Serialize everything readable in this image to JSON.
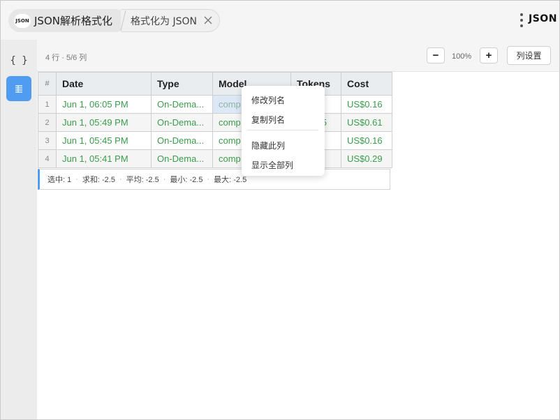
{
  "header": {
    "app_badge": "JSON",
    "app_title": "JSON解析格式化",
    "tab_label": "格式化为 JSON",
    "brand": "JSON"
  },
  "sidebar": {
    "items": [
      {
        "label": "{ }",
        "icon": "braces-icon",
        "active": false
      },
      {
        "label": "",
        "icon": "table-view-icon",
        "active": true
      }
    ]
  },
  "toolbar": {
    "summary": "4 行 · 5/6 列",
    "zoom_out": "−",
    "zoom_level": "100%",
    "zoom_in": "+",
    "column_settings": "列设置"
  },
  "table": {
    "index_header": "#",
    "columns": [
      "Date",
      "Type",
      "Model",
      "Tokens",
      "Cost"
    ],
    "rows": [
      {
        "index": "1",
        "date": "Jun 1, 06:05 PM",
        "type": "On-Dema...",
        "model": "comp",
        "tokens": "",
        "cost": "US$0.16"
      },
      {
        "index": "2",
        "date": "Jun 1, 05:49 PM",
        "type": "On-Dema...",
        "model": "comp",
        "tokens": "5",
        "cost": "US$0.61"
      },
      {
        "index": "3",
        "date": "Jun 1, 05:45 PM",
        "type": "On-Dema...",
        "model": "comp",
        "tokens": "",
        "cost": "US$0.16"
      },
      {
        "index": "4",
        "date": "Jun 1, 05:41 PM",
        "type": "On-Dema...",
        "model": "comp",
        "tokens": "",
        "cost": "US$0.29"
      }
    ],
    "selected_cell": {
      "row": 1,
      "column": "Model"
    }
  },
  "status": {
    "selected": "选中: 1",
    "sum": "求和: -2.5",
    "avg": "平均: -2.5",
    "min": "最小: -2.5",
    "max": "最大: -2.5"
  },
  "context_menu": {
    "items": [
      "修改列名",
      "复制列名",
      "隐藏此列",
      "显示全部列"
    ]
  },
  "colors": {
    "accent": "#4f9cf0",
    "value_green": "#3a9d4c",
    "header_bg": "#eaedf0"
  }
}
